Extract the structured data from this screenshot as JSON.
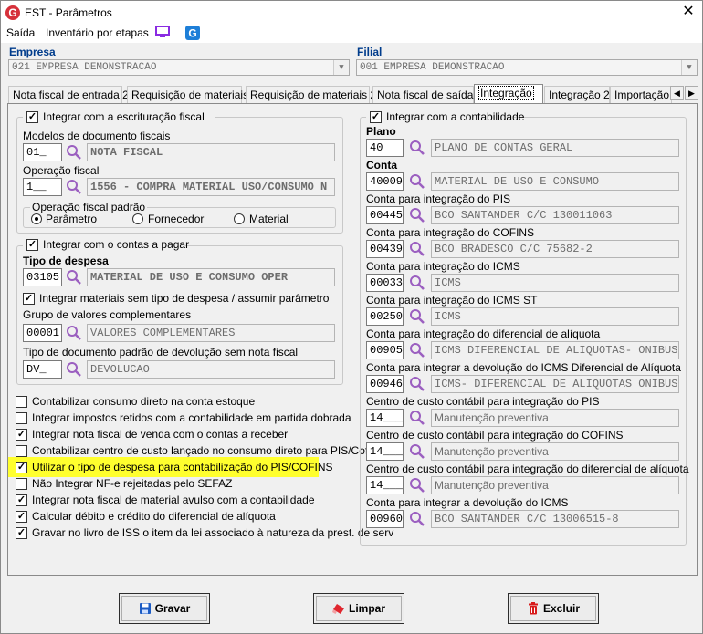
{
  "window": {
    "title": "EST - Parâmetros",
    "close": "✕"
  },
  "menu": {
    "saida": "Saída",
    "inventario": "Inventário por etapas"
  },
  "empresa": {
    "label": "Empresa",
    "value": "021 EMPRESA DEMONSTRACAO"
  },
  "filial": {
    "label": "Filial",
    "value": "001 EMPRESA DEMONSTRACAO"
  },
  "tabs": [
    {
      "label": "Nota fiscal de entrada 2"
    },
    {
      "label": "Requisição de materiais"
    },
    {
      "label": "Requisição de materiais 2"
    },
    {
      "label": "Nota fiscal de saída"
    },
    {
      "label": "Integração"
    },
    {
      "label": "Integração 2"
    },
    {
      "label": "Importação XI"
    }
  ],
  "left": {
    "fiscal": {
      "title": "Integrar com a escrituração fiscal",
      "modelos_label": "Modelos de documento fiscais",
      "modelos_code": "01_",
      "modelos_desc": "NOTA FISCAL",
      "operacao_label": "Operação fiscal",
      "operacao_code": "1__",
      "operacao_desc": "1556 - COMPRA MATERIAL USO/CONSUMO N",
      "padrao_title": "Operação fiscal padrão",
      "radio_parametro": "Parâmetro",
      "radio_fornecedor": "Fornecedor",
      "radio_material": "Material"
    },
    "pagar": {
      "title": "Integrar com o contas a pagar",
      "tipo_label": "Tipo de despesa",
      "tipo_code": "03105",
      "tipo_desc": "MATERIAL DE USO E CONSUMO OPER",
      "sem_tipo": "Integrar materiais sem tipo de despesa / assumir parâmetro",
      "grupo_label": "Grupo de valores complementares",
      "grupo_code": "00001",
      "grupo_desc": "VALORES COMPLEMENTARES",
      "devolucao_label": "Tipo de documento padrão de devolução sem nota fiscal",
      "devolucao_code": "DV_",
      "devolucao_desc": "DEVOLUCAO"
    },
    "options": [
      {
        "label": "Contabilizar consumo direto na conta estoque",
        "checked": false
      },
      {
        "label": "Integrar impostos retidos com a contabilidade em partida dobrada",
        "checked": false
      },
      {
        "label": "Integrar nota fiscal de venda com o contas a receber",
        "checked": true
      },
      {
        "label": "Contabilizar centro de custo lançado no consumo direto para PIS/Cofins",
        "checked": false
      },
      {
        "label": "Utilizar o tipo de despesa para contabilização do PIS/COFINS",
        "checked": true
      },
      {
        "label": "Não Integrar NF-e rejeitadas pelo SEFAZ",
        "checked": false
      },
      {
        "label": "Integrar nota fiscal de material avulso com a contabilidade",
        "checked": true
      },
      {
        "label": "Calcular débito e crédito do diferencial de alíquota",
        "checked": true
      },
      {
        "label": "Gravar no livro de ISS o item da lei associado à natureza da prest. de serv",
        "checked": true
      }
    ]
  },
  "right": {
    "title": "Integrar com a contabilidade",
    "plano_label": "Plano",
    "plano_code": "40",
    "plano_desc": "PLANO DE CONTAS GERAL",
    "conta_label": "Conta",
    "conta_code": "40009",
    "conta_desc": "MATERIAL DE USO E CONSUMO",
    "rows": [
      {
        "label": "Conta para integração do PIS",
        "code": "00445",
        "desc": "BCO SANTANDER C/C 130011063"
      },
      {
        "label": "Conta para integração do COFINS",
        "code": "00439",
        "desc": "BCO BRADESCO C/C 75682-2"
      },
      {
        "label": "Conta para integração do ICMS",
        "code": "00033",
        "desc": "ICMS"
      },
      {
        "label": "Conta para integração do ICMS ST",
        "code": "00250",
        "desc": "ICMS"
      },
      {
        "label": "Conta para integração do diferencial de alíquota",
        "code": "00905",
        "desc": "ICMS DIFERENCIAL DE ALIQUOTAS- ONIBUS"
      },
      {
        "label": "Conta para integrar a devolução do ICMS Diferencial de Alíquota",
        "code": "00946",
        "desc": "ICMS- DIFERENCIAL DE ALIQUOTAS ONIBUS"
      },
      {
        "label": "Centro de custo contábil para integração do PIS",
        "code": "14___",
        "desc": "Manutenção preventiva"
      },
      {
        "label": "Centro de custo contábil para integração do COFINS",
        "code": "14___",
        "desc": "Manutenção preventiva"
      },
      {
        "label": "Centro de custo contábil para integração do diferencial de alíquota",
        "code": "14___",
        "desc": "Manutenção preventiva"
      },
      {
        "label": "Conta para integrar a devolução do ICMS",
        "code": "00960",
        "desc": "BCO SANTANDER C/C 13006515-8"
      }
    ]
  },
  "buttons": {
    "gravar": "Gravar",
    "limpar": "Limpar",
    "excluir": "Excluir"
  },
  "colors": {
    "accent": "#003c8c",
    "highlight": "#ffff2e",
    "search_icon": "#9b5fc0"
  }
}
